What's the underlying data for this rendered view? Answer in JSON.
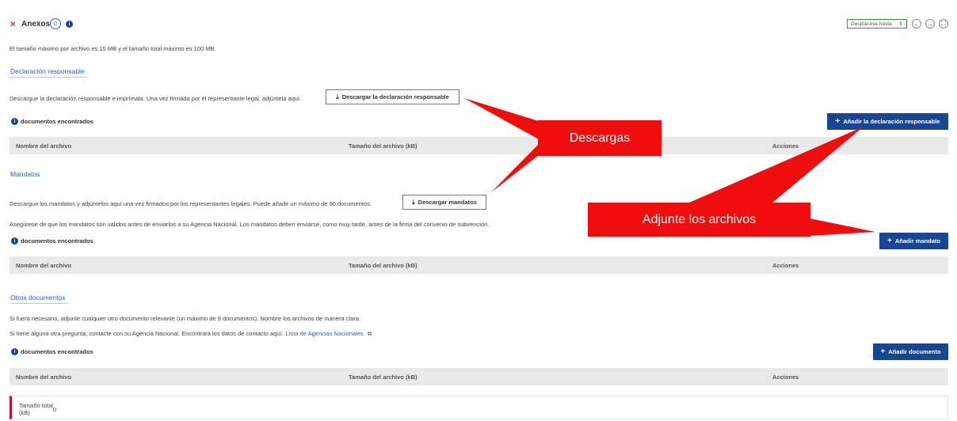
{
  "header": {
    "close_glyph": "×",
    "title": "Anexos",
    "count": "0",
    "info_glyph": "i",
    "jump_select": "Desplácese hasta",
    "jump_caret": "⇕",
    "prev_glyph": "←",
    "next_glyph": "→",
    "fullscreen_glyph": "⛶"
  },
  "size_note": "El tamaño máximo por archivo es 15 MB y el tamaño total máximo es 100 MB.",
  "declaracion": {
    "title": "Declaración responsable",
    "instructions": "Descargue la declaración responsable e imprímala. Una vez firmada por el representante legal, adjúntela aquí.",
    "download_button": "Descargar la declaración responsable",
    "found_text": "documentos encontrados",
    "add_button": "Añadir la declaración responsable"
  },
  "mandatos": {
    "title": "Mandatos",
    "instructions": "Descargue los mandatos y adjúntelos aquí una vez firmados por los representantes legales. Puede añadir un máximo de 90 documentos.",
    "download_button": "Descargar mandatos",
    "note": "Asegúrese de que los mandatos son válidos antes de enviarlos a su Agencia Nacional. Los mandatos deben enviarse, como muy tarde, antes de la firma del convenio de subvención.",
    "found_text": "documentos encontrados",
    "add_button": "Añadir mandato"
  },
  "otros": {
    "title": "Otros documentos",
    "instructions": "Si fuera necesario, adjunte cualquier otro documento relevante (un máximo de 9 documentos). Nombre los archivos de manera clara.",
    "contact": "Si tiene alguna otra pregunta, contacte con su Agencia Nacional. Encontrará los datos de contacto aquí:",
    "contact_link": "Lista de Agencias Nacionales.",
    "external_glyph": "⧉",
    "found_text": "documentos encontrados",
    "add_button": "Añadir documento"
  },
  "table_columns": {
    "name": "Nombre del archivo",
    "size": "Tamaño del archivo (kB)",
    "actions": "Acciones"
  },
  "total": {
    "label_line1": "Tamaño total",
    "label_line2": "(kB)",
    "value": "0"
  },
  "callouts": {
    "downloads": "Descargas",
    "attach": "Adjunte los archivos"
  },
  "colors": {
    "primary_button": "#1a4590",
    "callout": "#ef0d0d",
    "link": "#2a64a8",
    "close": "#d0201a",
    "jump_border": "#3b8f3b",
    "total_accent": "#c8102e"
  },
  "icons": {
    "close": "close-icon",
    "info": "info-icon",
    "download": "download-icon",
    "plus": "plus-icon",
    "external_link": "external-link-icon",
    "prev": "arrow-left-icon",
    "next": "arrow-right-icon",
    "fullscreen": "fullscreen-icon"
  }
}
